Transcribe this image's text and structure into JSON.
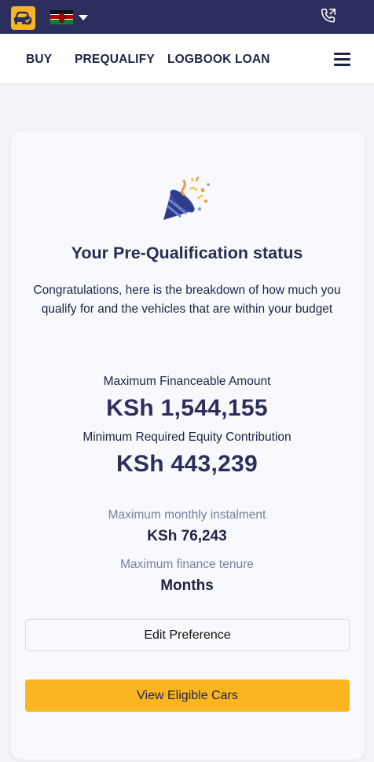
{
  "header": {
    "logo_icon": "car-check-icon",
    "country_flag": "kenya-flag-icon",
    "phone_icon": "phone-call-icon",
    "brand_color": "#2c2f5e",
    "accent_color": "#fbb521"
  },
  "nav": {
    "items": [
      {
        "label": "BUY"
      },
      {
        "label": "PREQUALIFY"
      },
      {
        "label": "LOGBOOK LOAN"
      }
    ],
    "menu_icon": "hamburger-menu-icon"
  },
  "status": {
    "icon": "party-popper-icon",
    "heading": "Your Pre-Qualification status",
    "intro": "Congratulations, here is the breakdown of how much you qualify for and the vehicles that are within your budget",
    "max_financeable_label": "Maximum Financeable Amount",
    "max_financeable_value": "KSh 1,544,155",
    "min_equity_label": "Minimum Required Equity Contribution",
    "min_equity_value": "KSh 443,239",
    "monthly_instalment_label": "Maximum monthly instalment",
    "monthly_instalment_value": "KSh 76,243",
    "tenure_label": "Maximum finance tenure",
    "tenure_value": "Months"
  },
  "actions": {
    "edit_label": "Edit Preference",
    "view_label": "View Eligible Cars"
  }
}
